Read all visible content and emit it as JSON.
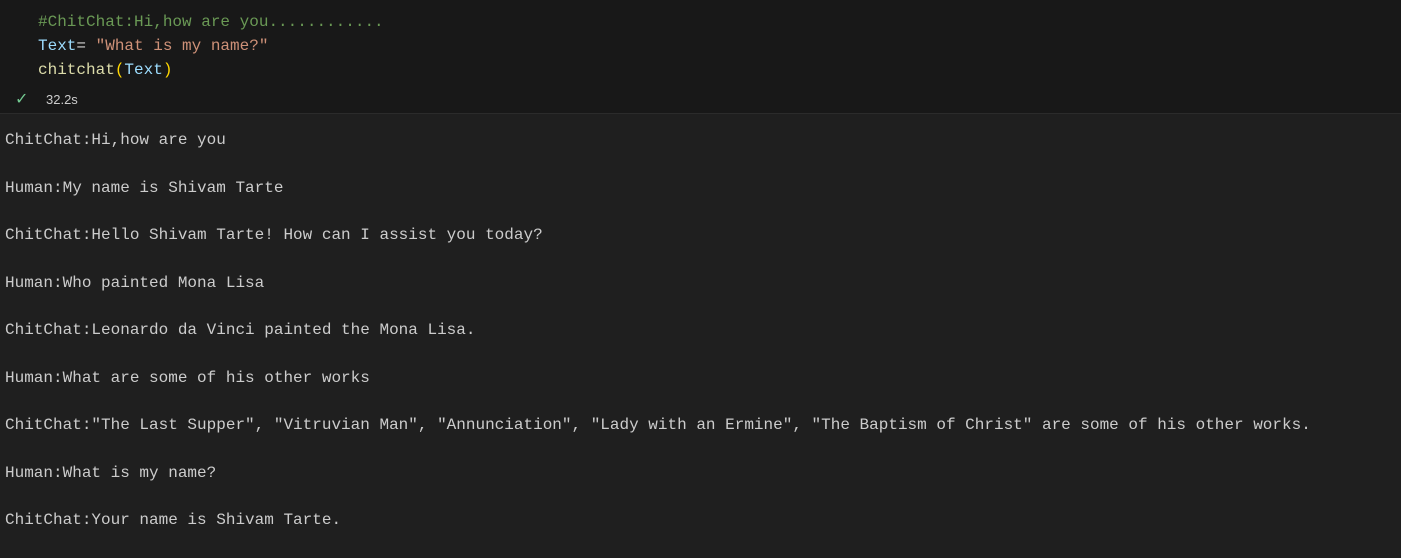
{
  "code": {
    "comment": "#ChitChat:Hi,how are you............",
    "line2": {
      "var": "Text",
      "op": "= ",
      "str": "\"What is my name?\""
    },
    "line3": {
      "fn": "chitchat",
      "open": "(",
      "arg": "Text",
      "close": ")"
    }
  },
  "status": {
    "icon": "check-icon",
    "duration": "32.2s"
  },
  "output": [
    "ChitChat:Hi,how are you",
    "Human:My name is Shivam Tarte",
    "ChitChat:Hello Shivam Tarte! How can I assist you today?",
    "Human:Who painted Mona Lisa",
    "ChitChat:Leonardo da Vinci painted the Mona Lisa.",
    "Human:What are some of his other works",
    "ChitChat:\"The Last Supper\", \"Vitruvian Man\", \"Annunciation\", \"Lady with an Ermine\", \"The Baptism of Christ\" are some of his other works.",
    "Human:What is my name?",
    "ChitChat:Your name is Shivam Tarte."
  ]
}
